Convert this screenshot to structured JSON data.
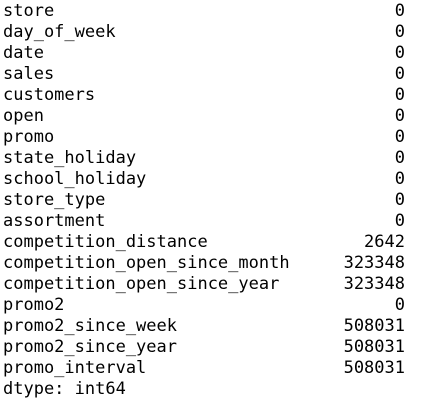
{
  "series": [
    {
      "name": "store",
      "value": "0"
    },
    {
      "name": "day_of_week",
      "value": "0"
    },
    {
      "name": "date",
      "value": "0"
    },
    {
      "name": "sales",
      "value": "0"
    },
    {
      "name": "customers",
      "value": "0"
    },
    {
      "name": "open",
      "value": "0"
    },
    {
      "name": "promo",
      "value": "0"
    },
    {
      "name": "state_holiday",
      "value": "0"
    },
    {
      "name": "school_holiday",
      "value": "0"
    },
    {
      "name": "store_type",
      "value": "0"
    },
    {
      "name": "assortment",
      "value": "0"
    },
    {
      "name": "competition_distance",
      "value": "2642"
    },
    {
      "name": "competition_open_since_month",
      "value": "323348"
    },
    {
      "name": "competition_open_since_year",
      "value": "323348"
    },
    {
      "name": "promo2",
      "value": "0"
    },
    {
      "name": "promo2_since_week",
      "value": "508031"
    },
    {
      "name": "promo2_since_year",
      "value": "508031"
    },
    {
      "name": "promo_interval",
      "value": "508031"
    }
  ],
  "dtype_line": "dtype: int64"
}
